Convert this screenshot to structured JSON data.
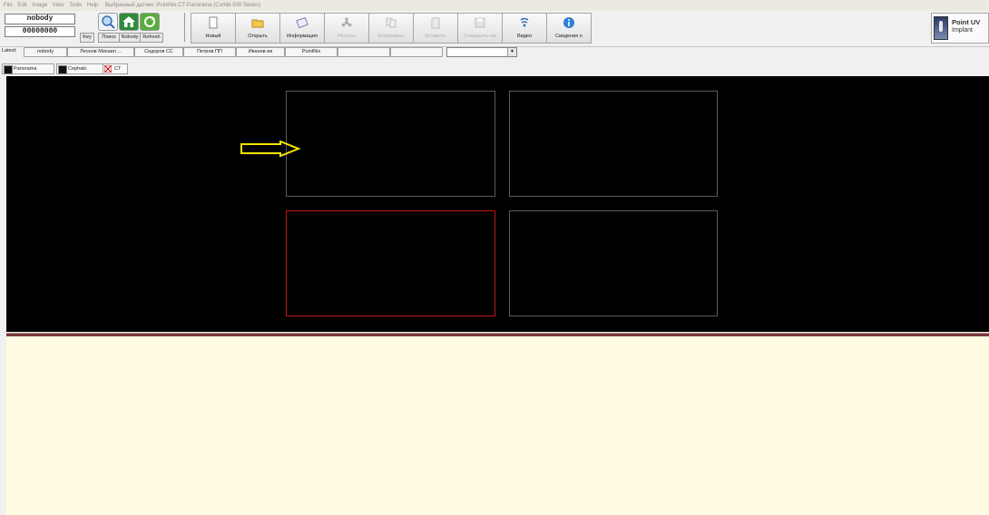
{
  "menu": {
    "items": [
      "File",
      "Edit",
      "Image",
      "View",
      "Tools",
      "Help"
    ],
    "status": "Выбранный датчик: PointNix CT-Panorama (Combi 500 Series)"
  },
  "patient": {
    "name": "nobody",
    "id": "00000000",
    "key_label": "Key",
    "search_label": "Поиск",
    "nobody_label": "Nobody",
    "refresh_label": "Refresh"
  },
  "toolbar": [
    {
      "label": "Новый",
      "icon": "new-document-icon",
      "enabled": true
    },
    {
      "label": "Открыть",
      "icon": "open-folder-icon",
      "enabled": true
    },
    {
      "label": "Информация",
      "icon": "info-card-icon",
      "enabled": true
    },
    {
      "label": "Рентген",
      "icon": "xray-radiation-icon",
      "enabled": false
    },
    {
      "label": "Копировать",
      "icon": "copy-icon",
      "enabled": false
    },
    {
      "label": "Вставить",
      "icon": "paste-icon",
      "enabled": false
    },
    {
      "label": "Сохранить как",
      "icon": "save-icon",
      "enabled": false
    },
    {
      "label": "Видео",
      "icon": "video-icon",
      "enabled": true
    },
    {
      "label": "Сведения о",
      "icon": "about-icon",
      "enabled": true
    }
  ],
  "brand": {
    "line1": "Point UV",
    "line2": "Implant"
  },
  "latest": {
    "label": "Latest:",
    "items": [
      "nobody",
      "Леонов Михаил ...",
      "Сидоров СС",
      "Петров ПП",
      "Иванов ии",
      "PointNix",
      "",
      ""
    ]
  },
  "tabs": [
    {
      "label": "Panorama",
      "icon": "panorama-icon"
    },
    {
      "label": "Cephalo",
      "icon": "cephalo-icon"
    },
    {
      "label": "CT",
      "icon": "ct-icon"
    }
  ],
  "colors": {
    "selected_pane": "#c0171b",
    "arrow": "#f5e400",
    "bottom_panel": "#fffbe3"
  }
}
